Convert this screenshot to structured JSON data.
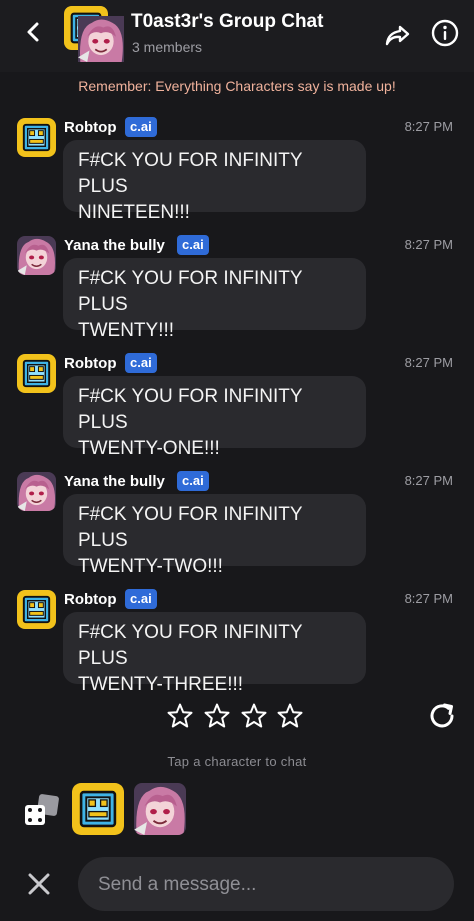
{
  "header": {
    "title": "T0ast3r's Group Chat",
    "members": "3 members"
  },
  "notice": "Remember: Everything Characters say is made up!",
  "messages": [
    {
      "sender": "Robtop",
      "badge": "c.ai",
      "time": "8:27 PM",
      "line1": "F#CK YOU FOR INFINITY PLUS",
      "line2": "NINETEEN!!!",
      "avatar": "robtop-avatar"
    },
    {
      "sender": "Yana the bully",
      "badge": "c.ai",
      "time": "8:27 PM",
      "line1": "F#CK YOU FOR INFINITY PLUS",
      "line2": "TWENTY!!!",
      "avatar": "yana-avatar"
    },
    {
      "sender": "Robtop",
      "badge": "c.ai",
      "time": "8:27 PM",
      "line1": "F#CK YOU FOR INFINITY PLUS",
      "line2": "TWENTY-ONE!!!",
      "avatar": "robtop-avatar"
    },
    {
      "sender": "Yana the bully",
      "badge": "c.ai",
      "time": "8:27 PM",
      "line1": "F#CK YOU FOR INFINITY PLUS",
      "line2": "TWENTY-TWO!!!",
      "avatar": "yana-avatar"
    },
    {
      "sender": "Robtop",
      "badge": "c.ai",
      "time": "8:27 PM",
      "line1": "F#CK YOU FOR INFINITY PLUS",
      "line2": "TWENTY-THREE!!!",
      "avatar": "robtop-avatar"
    }
  ],
  "rating": {
    "stars_filled": 0,
    "stars_total": 4
  },
  "hint": "Tap a character to chat",
  "composer": {
    "placeholder": "Send a message..."
  },
  "colors": {
    "background": "#18181b",
    "bubble": "#2a2a2e",
    "badge": "#2f6bd8",
    "notice": "#f0b29c"
  },
  "icons": {
    "back": "chevron-left-icon",
    "share": "share-arrow-icon",
    "info": "info-icon",
    "refresh": "refresh-icon",
    "dice": "dice-icon",
    "close": "close-icon",
    "star": "star-outline-icon"
  }
}
